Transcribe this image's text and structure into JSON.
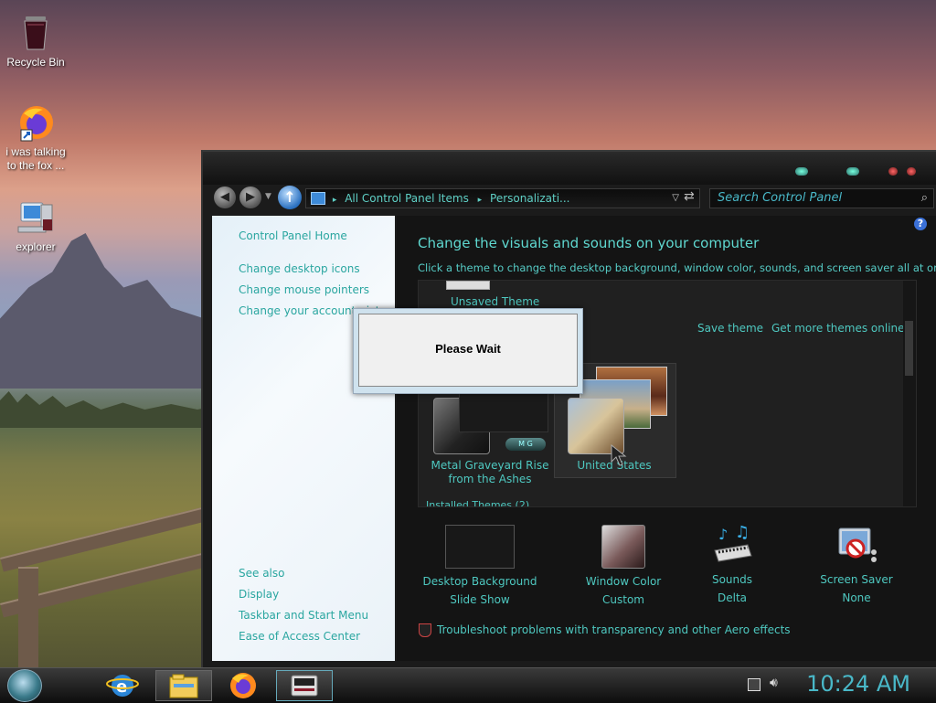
{
  "desktop": {
    "icons": [
      {
        "label": "Recycle Bin",
        "icon": "recycle-bin-icon"
      },
      {
        "label": "i was talking to the fox ...",
        "icon": "firefox-shortcut-icon"
      },
      {
        "label": "explorer",
        "icon": "explorer-computer-icon"
      }
    ]
  },
  "window": {
    "address": {
      "crumb1": "All Control Panel Items",
      "separator": "▸",
      "crumb2": "Personalizati..."
    },
    "search_placeholder": "Search Control Panel",
    "left_pane": {
      "links": [
        "Control Panel Home",
        "Change desktop icons",
        "Change mouse pointers",
        "Change your account picture"
      ],
      "see_also_label": "See also",
      "see_also": [
        "Display",
        "Taskbar and Start Menu",
        "Ease of Access Center"
      ]
    },
    "main": {
      "heading": "Change the visuals and sounds on your computer",
      "subheading": "Click a theme to change the desktop background, window color, sounds, and screen saver all at once.",
      "themes": {
        "unsaved_label": "Unsaved Theme",
        "save_theme": "Save theme",
        "get_more": "Get more themes online",
        "theme1_line1": "Metal Graveyard Rise",
        "theme1_line2": "from the Ashes",
        "theme2": "United States",
        "installed_label": "Installed Themes (2)"
      },
      "bottom": [
        {
          "label": "Desktop Background",
          "value": "Slide Show"
        },
        {
          "label": "Window Color",
          "value": "Custom"
        },
        {
          "label": "Sounds",
          "value": "Delta"
        },
        {
          "label": "Screen Saver",
          "value": "None"
        }
      ],
      "troubleshoot": "Troubleshoot problems with transparency and other Aero effects"
    },
    "dialog": {
      "text": "Please Wait"
    }
  },
  "taskbar": {
    "clock": "10:24 AM",
    "items": [
      "start-orb-icon",
      "internet-explorer-icon",
      "file-explorer-icon",
      "firefox-icon",
      "control-panel-icon"
    ]
  },
  "colors": {
    "accent": "#4ec8c0",
    "clock": "#49b8c8"
  }
}
